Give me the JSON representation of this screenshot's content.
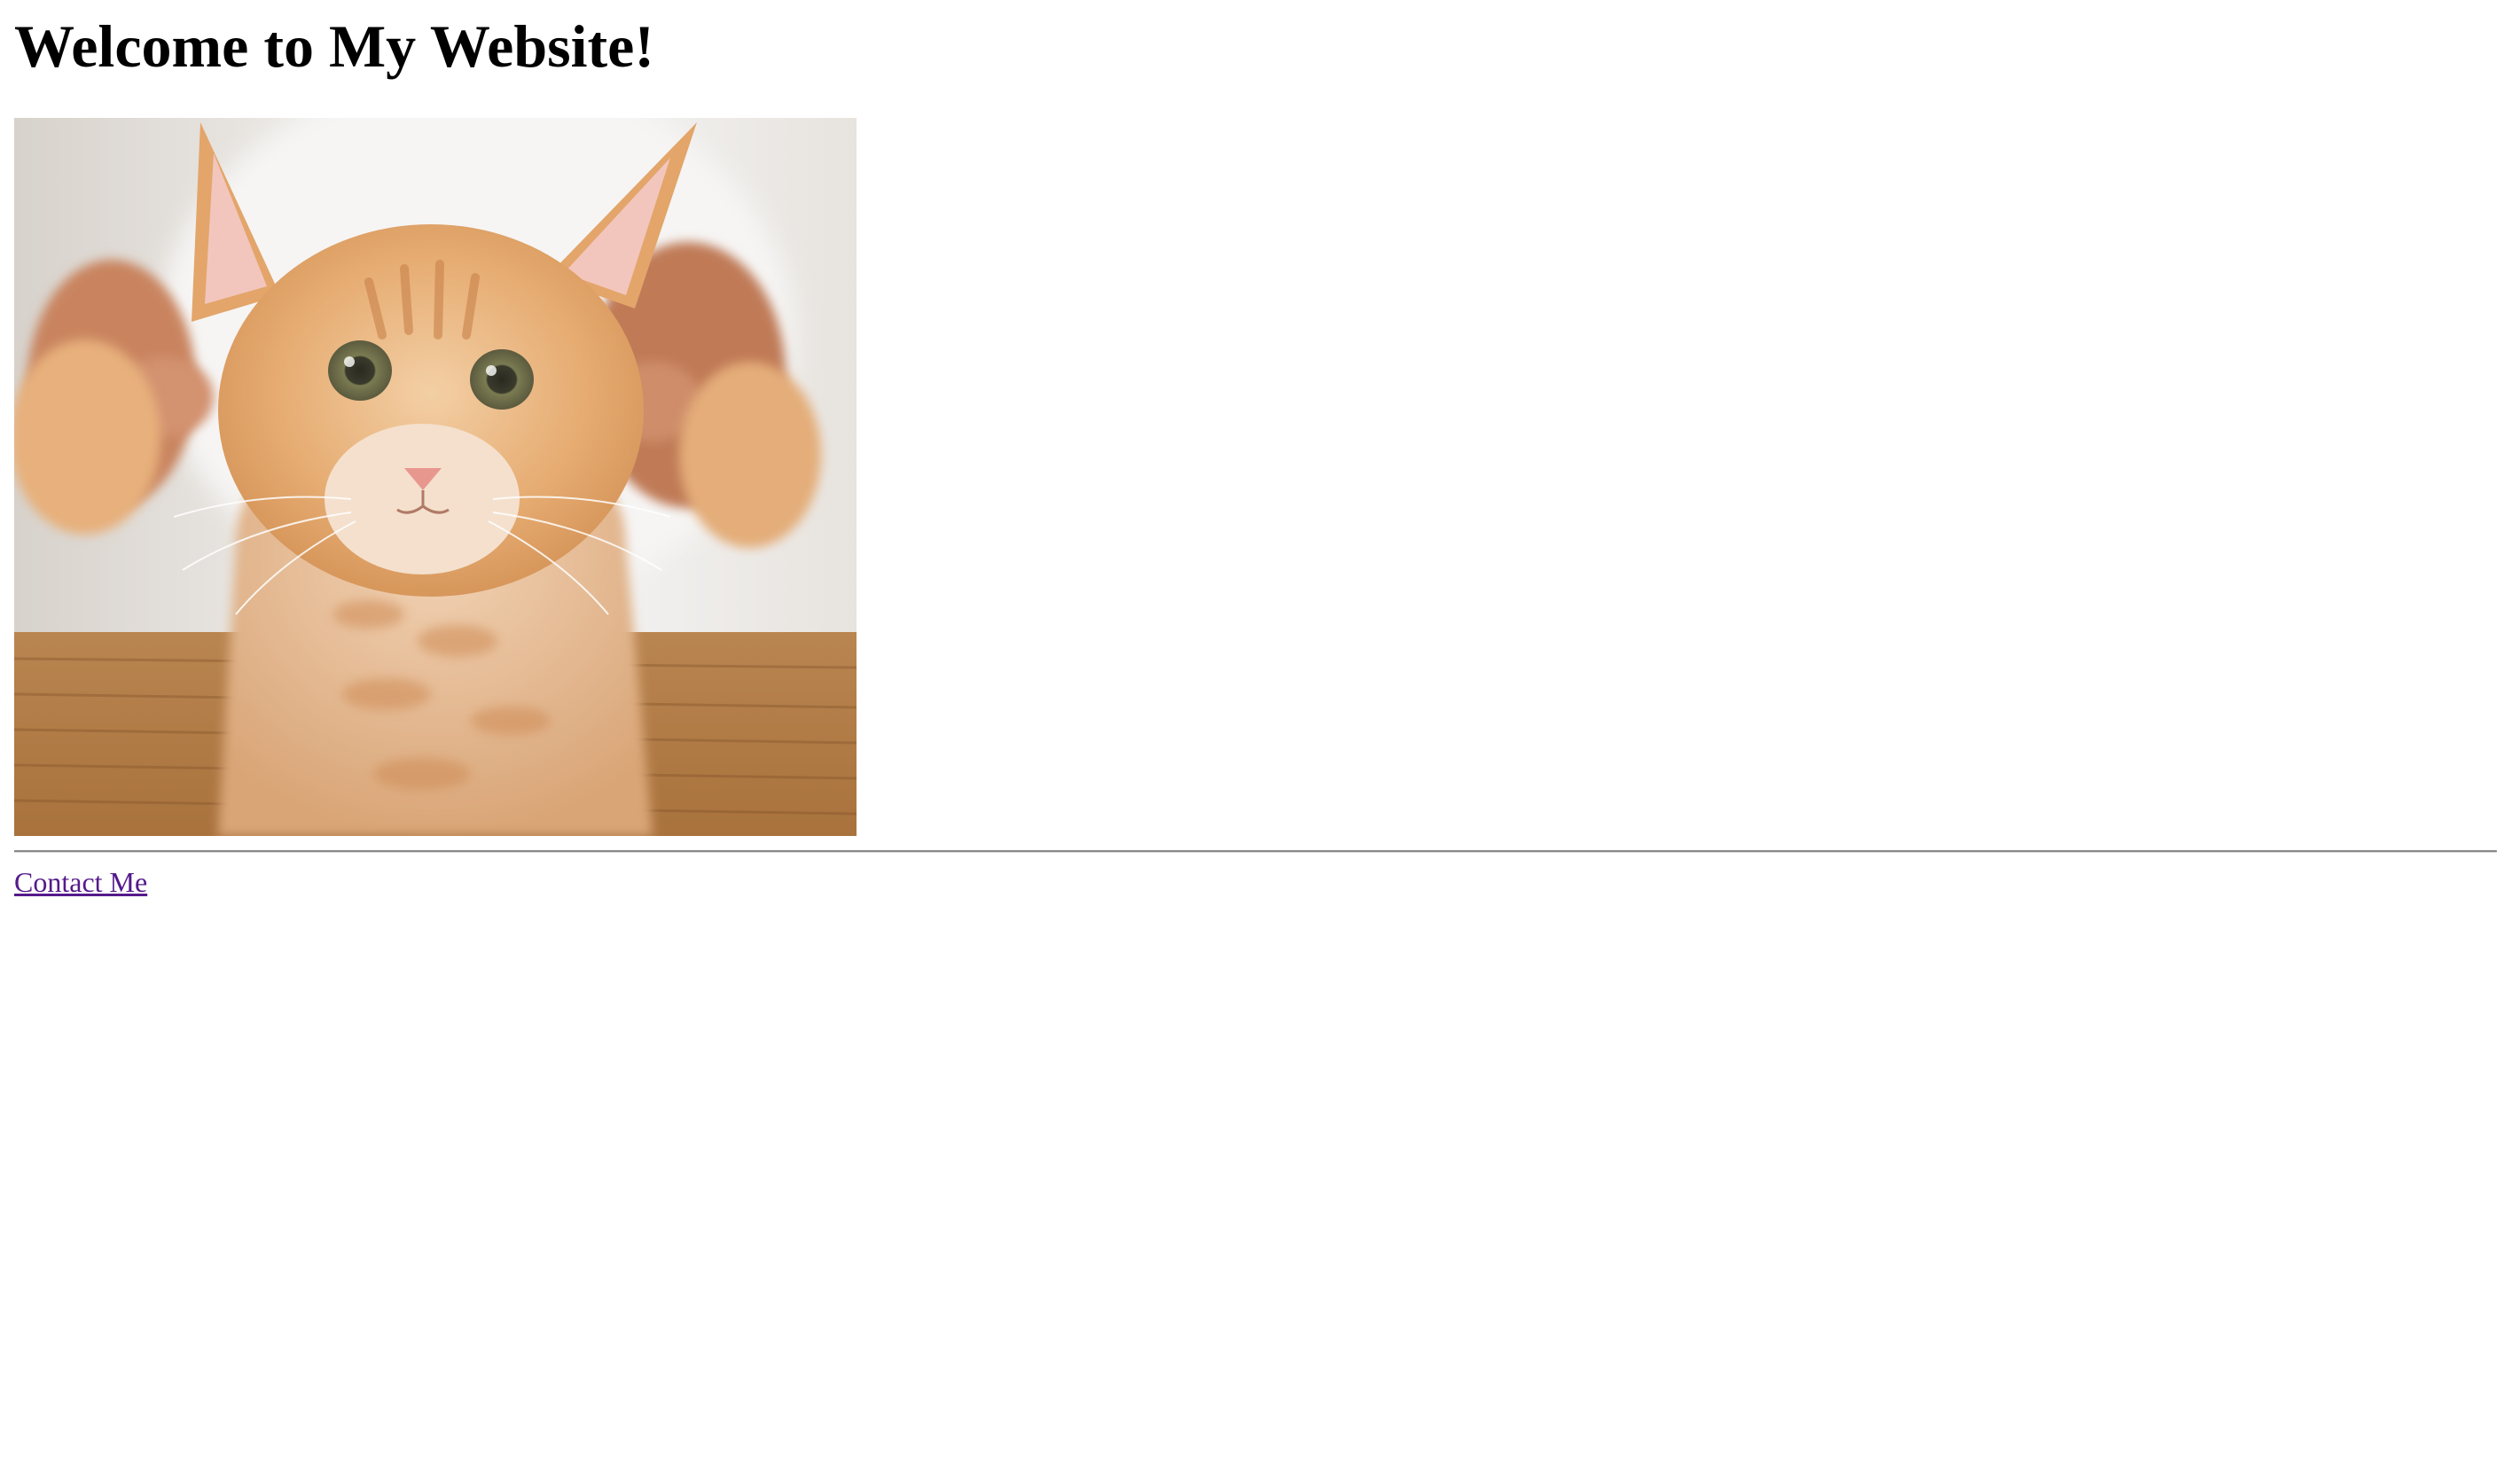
{
  "header": {
    "title": "Welcome to My Website!"
  },
  "content": {
    "image": {
      "subject": "orange-tabby-kitten-photo"
    }
  },
  "footer": {
    "contact_link_label": "Contact Me"
  },
  "colors": {
    "text": "#000000",
    "background": "#ffffff",
    "visited_link": "#551a8b",
    "rule": "#8a8a8a"
  }
}
